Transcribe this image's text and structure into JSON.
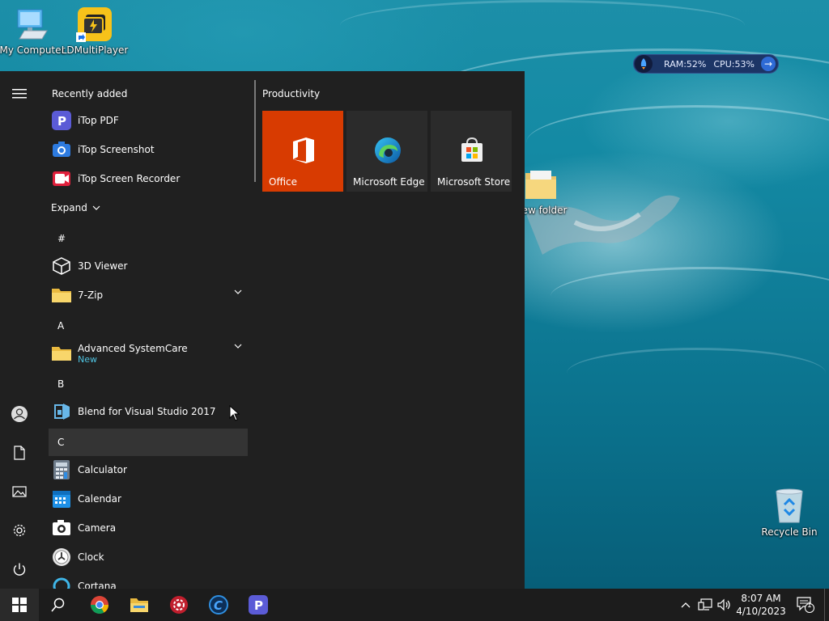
{
  "desktop": {
    "icons": [
      {
        "label": "My Computer"
      },
      {
        "label": "LDMultiPlayer"
      },
      {
        "label": "New folder"
      },
      {
        "label": "Recycle Bin"
      }
    ],
    "monitor": {
      "ram": "RAM:52%",
      "cpu": "CPU:53%"
    }
  },
  "start_menu": {
    "recently_added_title": "Recently added",
    "recent": [
      {
        "label": "iTop PDF",
        "icon": "itop-pdf-icon",
        "color": "#5b5bd6"
      },
      {
        "label": "iTop Screenshot",
        "icon": "itop-screenshot-icon",
        "color": "#2d7be0"
      },
      {
        "label": "iTop Screen Recorder",
        "icon": "itop-screen-recorder-icon",
        "color": "#e0203c"
      }
    ],
    "expand_label": "Expand",
    "groups": {
      "hash": "#",
      "a": "A",
      "b": "B",
      "c": "C"
    },
    "apps": {
      "viewer3d": "3D Viewer",
      "zip7": "7-Zip",
      "asc": "Advanced SystemCare",
      "asc_badge": "New",
      "blend": "Blend for Visual Studio 2017",
      "calculator": "Calculator",
      "calendar": "Calendar",
      "camera": "Camera",
      "clock": "Clock",
      "cortana": "Cortana"
    },
    "tiles_group": "Productivity",
    "tiles": [
      {
        "label": "Office",
        "color": "#d83b01"
      },
      {
        "label": "Microsoft Edge",
        "color": "#2b2b2b"
      },
      {
        "label": "Microsoft Store",
        "color": "#2b2b2b"
      }
    ]
  },
  "taskbar": {
    "time": "8:07 AM",
    "date": "4/10/2023",
    "notifications": "1"
  }
}
